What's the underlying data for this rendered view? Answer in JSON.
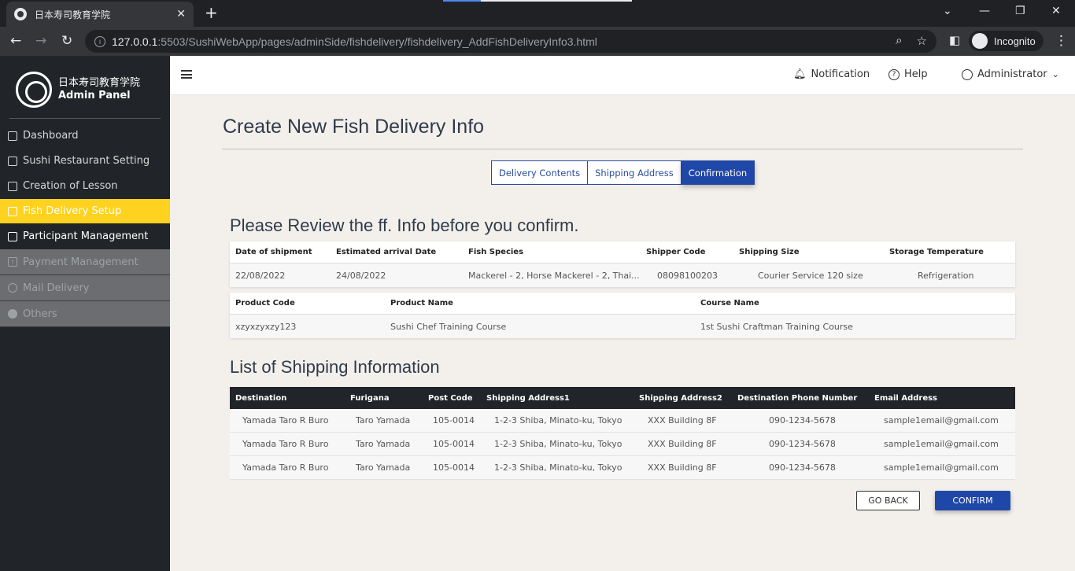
{
  "browser": {
    "tab_title": "日本寿司教育学院",
    "url_host": "127.0.0.1",
    "url_path": ":5503/SushiWebApp/pages/adminSide/fishdelivery/fishdelivery_AddFishDeliveryInfo3.html",
    "incognito_label": "Incognito"
  },
  "sidebar": {
    "brand_line1": "日本寿司教育学院",
    "brand_line2": "Admin Panel",
    "items": [
      {
        "label": "Dashboard",
        "icon": "users-icon"
      },
      {
        "label": "Sushi Restaurant Setting",
        "icon": "document-icon"
      },
      {
        "label": "Creation of Lesson",
        "icon": "document-icon"
      },
      {
        "label": "Fish Delivery Setup",
        "icon": "document-icon"
      },
      {
        "label": "Participant Management",
        "icon": "id-card-icon"
      },
      {
        "label": "Payment Management",
        "icon": "warning-icon"
      },
      {
        "label": "Mail Delivery",
        "icon": "chat-icon"
      },
      {
        "label": "Others",
        "icon": "messenger-icon"
      }
    ]
  },
  "topbar": {
    "notification": "Notification",
    "help": "Help",
    "user": "Administrator"
  },
  "page": {
    "title": "Create New Fish Delivery Info",
    "steps": [
      "Delivery Contents",
      "Shipping Address",
      "Confirmation"
    ],
    "review_heading": "Please Review the ff. Info before you confirm.",
    "shipping_heading": "List of Shipping Information"
  },
  "delivery_table": {
    "headers": [
      "Date of shipment",
      "Estimated arrival Date",
      "Fish Species",
      "Shipper Code",
      "Shipping Size",
      "Storage Temperature"
    ],
    "row": [
      "22/08/2022",
      "24/08/2022",
      "Mackerel - 2, Horse Mackerel - 2, Thai...",
      "08098100203",
      "Courier Service 120 size",
      "Refrigeration"
    ]
  },
  "product_table": {
    "headers": [
      "Product Code",
      "Product Name",
      "Course Name"
    ],
    "row": [
      "xzyxzyxzy123",
      "Sushi Chef Training Course",
      "1st Sushi Craftman Training Course"
    ]
  },
  "shipping_table": {
    "headers": [
      "Destination",
      "Furigana",
      "Post Code",
      "Shipping Address1",
      "Shipping Address2",
      "Destination Phone Number",
      "Email Address"
    ],
    "rows": [
      [
        "Yamada Taro R Buro",
        "Taro Yamada",
        "105-0014",
        "1-2-3 Shiba, Minato-ku, Tokyo",
        "XXX Building 8F",
        "090-1234-5678",
        "sample1email@gmail.com"
      ],
      [
        "Yamada Taro R Buro",
        "Taro Yamada",
        "105-0014",
        "1-2-3 Shiba, Minato-ku, Tokyo",
        "XXX Building 8F",
        "090-1234-5678",
        "sample1email@gmail.com"
      ],
      [
        "Yamada Taro R Buro",
        "Taro Yamada",
        "105-0014",
        "1-2-3 Shiba, Minato-ku, Tokyo",
        "XXX Building 8F",
        "090-1234-5678",
        "sample1email@gmail.com"
      ]
    ]
  },
  "buttons": {
    "back": "GO BACK",
    "confirm": "CONFIRM"
  },
  "colors": {
    "accent": "#1f47a8",
    "sidebar_active": "#ffd21f",
    "sidebar_bg": "#212529"
  }
}
